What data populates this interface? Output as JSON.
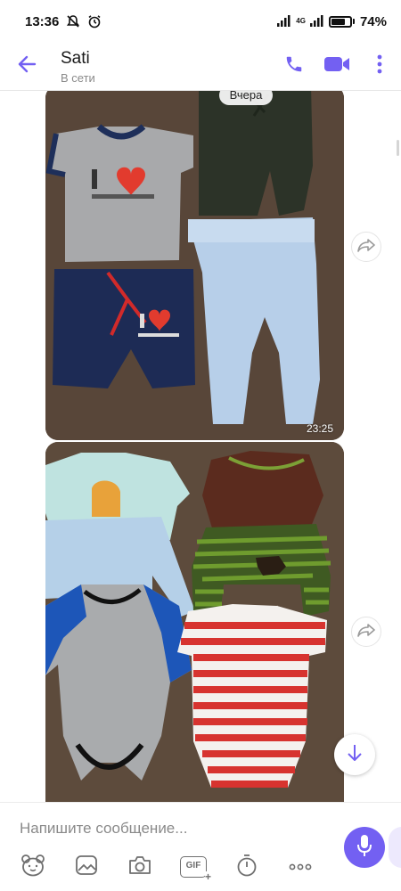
{
  "status_bar": {
    "time": "13:36",
    "network": "4G",
    "battery": "74%",
    "battery_level": 0.74
  },
  "header": {
    "contact_name": "Sati",
    "contact_status": "В сети",
    "icons": [
      "back-arrow-icon",
      "phone-icon",
      "video-camera-icon",
      "more-vertical-icon"
    ]
  },
  "chat": {
    "date_separator": "Вчера",
    "messages": [
      {
        "type": "photo",
        "time": "23:25"
      },
      {
        "type": "photo",
        "time": ""
      }
    ]
  },
  "composer": {
    "placeholder": "Напишите сообщение...",
    "gif_label": "GIF",
    "tools": [
      "sticker-bear-icon",
      "gallery-icon",
      "camera-icon",
      "gif-icon",
      "timer-icon",
      "more-horizontal-icon"
    ]
  },
  "colors": {
    "accent": "#7360f2",
    "text": "#1a1a1a",
    "muted": "#8a8a8a"
  }
}
